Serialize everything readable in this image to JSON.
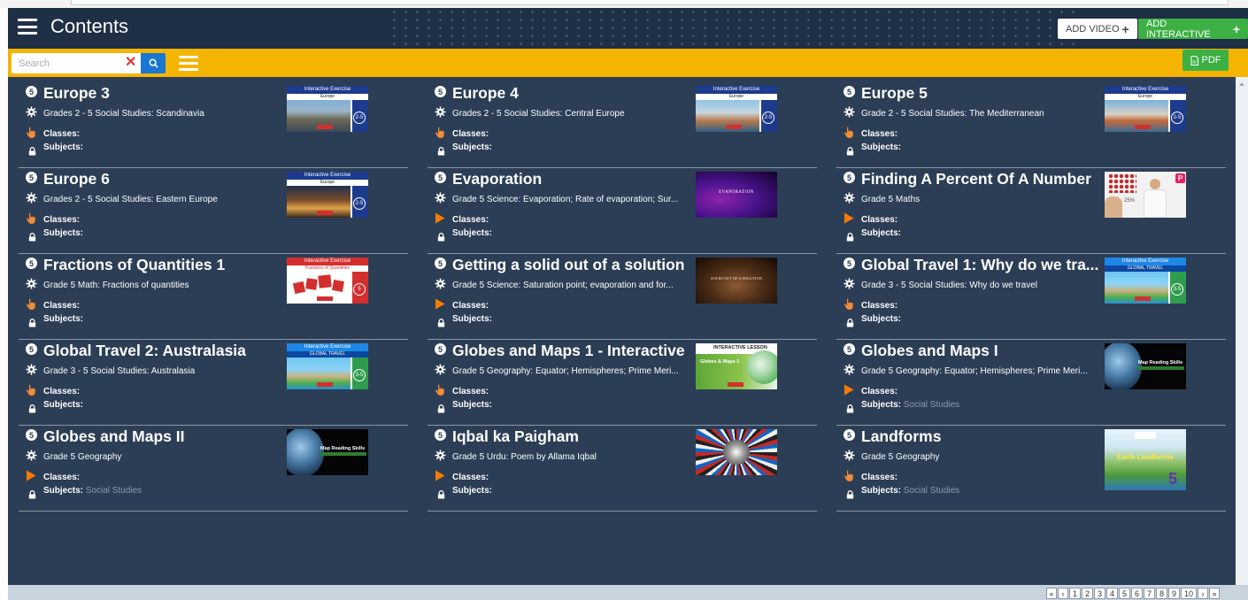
{
  "header": {
    "title": "Contents",
    "add_video_label": "ADD VIDEO",
    "add_interactive_label": "ADD INTERACTIVE",
    "pdf_label": "PDF"
  },
  "toolbar": {
    "search_placeholder": "Search",
    "search_value": ""
  },
  "cards": [
    {
      "number": "5",
      "title": "Europe 3",
      "description": "Grades 2 - 5 Social Studies: Scandinavia",
      "classes_label": "Classes:",
      "subjects_label": "Subjects:",
      "subjects_value": "",
      "activity_icon": "hand-pointer-icon",
      "thumb_type": "interactive",
      "thumb_bar": "Interactive Exercise",
      "thumb_sub": "Europe",
      "thumb_badge": "2-5"
    },
    {
      "number": "5",
      "title": "Europe 4",
      "description": "Grades 2 - 5 Social Studies: Central Europe",
      "classes_label": "Classes:",
      "subjects_label": "Subjects:",
      "subjects_value": "",
      "activity_icon": "hand-pointer-icon",
      "thumb_type": "interactive",
      "thumb_bar": "Interactive Exercise",
      "thumb_sub": "Europe",
      "thumb_badge": "2-5"
    },
    {
      "number": "5",
      "title": "Europe 5",
      "description": "Grade 2 - 5 Social Studies: The Mediterranean",
      "classes_label": "Classes:",
      "subjects_label": "Subjects:",
      "subjects_value": "",
      "activity_icon": "hand-pointer-icon",
      "thumb_type": "interactive",
      "thumb_bar": "Interactive Exercise",
      "thumb_sub": "Europe",
      "thumb_badge": "2-5"
    },
    {
      "number": "5",
      "title": "Europe 6",
      "description": "Grades 2 - 5 Social Studies: Eastern Europe",
      "classes_label": "Classes:",
      "subjects_label": "Subjects:",
      "subjects_value": "",
      "activity_icon": "hand-pointer-icon",
      "thumb_type": "interactive",
      "thumb_bar": "Interactive Exercise",
      "thumb_sub": "Europe",
      "thumb_badge": "2-5"
    },
    {
      "number": "5",
      "title": "Evaporation",
      "description": "Grade 5 Science: Evaporation; Rate of evaporation; Sur...",
      "classes_label": "Classes:",
      "subjects_label": "Subjects:",
      "subjects_value": "",
      "activity_icon": "play-icon",
      "thumb_type": "video-purple",
      "thumb_text": "EVAPORATION"
    },
    {
      "number": "5",
      "title": "Finding A Percent Of A Number",
      "description": "Grade 5 Maths",
      "classes_label": "Classes:",
      "subjects_label": "Subjects:",
      "subjects_value": "",
      "activity_icon": "play-icon",
      "thumb_type": "video-teacher",
      "thumb_text": "25%"
    },
    {
      "number": "5",
      "title": "Fractions of Quantities 1",
      "description": "Grade 5 Math: Fractions of quantities",
      "classes_label": "Classes:",
      "subjects_label": "Subjects:",
      "subjects_value": "",
      "activity_icon": "hand-pointer-icon",
      "thumb_type": "interactive-red",
      "thumb_bar": "Interactive Exercise",
      "thumb_sub": "Fractions of Quantities",
      "thumb_badge": "5"
    },
    {
      "number": "5",
      "title": "Getting a solid out of a solution",
      "description": "Grade 5 Science: Saturation point; evaporation and for...",
      "classes_label": "Classes:",
      "subjects_label": "Subjects:",
      "subjects_value": "",
      "activity_icon": "play-icon",
      "thumb_type": "video-dark",
      "thumb_text": "SOLID OUT OF A SOLUTION"
    },
    {
      "number": "5",
      "title": "Global Travel 1: Why do we tra...",
      "description": "Grade 3 - 5 Social Studies: Why do we travel",
      "classes_label": "Classes:",
      "subjects_label": "Subjects:",
      "subjects_value": "",
      "activity_icon": "hand-pointer-icon",
      "thumb_type": "interactive-map",
      "thumb_bar": "Interactive Exercise",
      "thumb_sub": "GLOBAL TRAVEL",
      "thumb_badge": "3-5"
    },
    {
      "number": "5",
      "title": "Global Travel 2: Australasia",
      "description": "Grade 3 - 5 Social Studies: Australasia",
      "classes_label": "Classes:",
      "subjects_label": "Subjects:",
      "subjects_value": "",
      "activity_icon": "hand-pointer-icon",
      "thumb_type": "interactive-map",
      "thumb_bar": "Interactive Exercise",
      "thumb_sub": "GLOBAL TRAVEL",
      "thumb_badge": "3-5"
    },
    {
      "number": "5",
      "title": "Globes and Maps 1 - Interactive",
      "description": "Grade 5 Geography: Equator; Hemispheres; Prime Meri...",
      "classes_label": "Classes:",
      "subjects_label": "Subjects:",
      "subjects_value": "",
      "activity_icon": "hand-pointer-icon",
      "thumb_type": "interactive-lesson",
      "thumb_bar": "INTERACTIVE LESSON",
      "thumb_sub": "Globes & Maps 1"
    },
    {
      "number": "5",
      "title": "Globes and Maps I",
      "description": "Grade 5 Geography: Equator; Hemispheres; Prime Meri...",
      "classes_label": "Classes:",
      "subjects_label": "Subjects:",
      "subjects_value": "Social Studies",
      "activity_icon": "play-icon",
      "thumb_type": "video-globe",
      "thumb_text": "Map Reading Skills"
    },
    {
      "number": "5",
      "title": "Globes and Maps II",
      "description": "Grade 5 Geography",
      "classes_label": "Classes:",
      "subjects_label": "Subjects:",
      "subjects_value": "Social Studies",
      "activity_icon": "play-icon",
      "thumb_type": "video-globe",
      "thumb_text": "Map Reading Skills"
    },
    {
      "number": "5",
      "title": "Iqbal ka Paigham",
      "description": "Grade 5 Urdu: Poem by Allama Iqbal",
      "classes_label": "Classes:",
      "subjects_label": "Subjects:",
      "subjects_value": "",
      "activity_icon": "play-icon",
      "thumb_type": "video-tunnel",
      "thumb_text": ""
    },
    {
      "number": "5",
      "title": "Landforms",
      "description": "Grade 5 Geography",
      "classes_label": "Classes:",
      "subjects_label": "Subjects:",
      "subjects_value": "Social Studies",
      "activity_icon": "hand-pointer-icon",
      "thumb_type": "landforms",
      "thumb_text": "Earth Landforms",
      "thumb_badge": "5"
    }
  ],
  "pagination": {
    "items": [
      "«",
      "‹",
      "1",
      "2",
      "3",
      "4",
      "5",
      "6",
      "7",
      "8",
      "9",
      "10",
      "›",
      "»"
    ]
  },
  "colors": {
    "header_bg": "#1f2f45",
    "content_bg": "#2c3e55",
    "toolbar_bg": "#f4b400",
    "accent_green": "#3cb043",
    "search_blue": "#1976d2",
    "play_orange": "#f57c00"
  }
}
